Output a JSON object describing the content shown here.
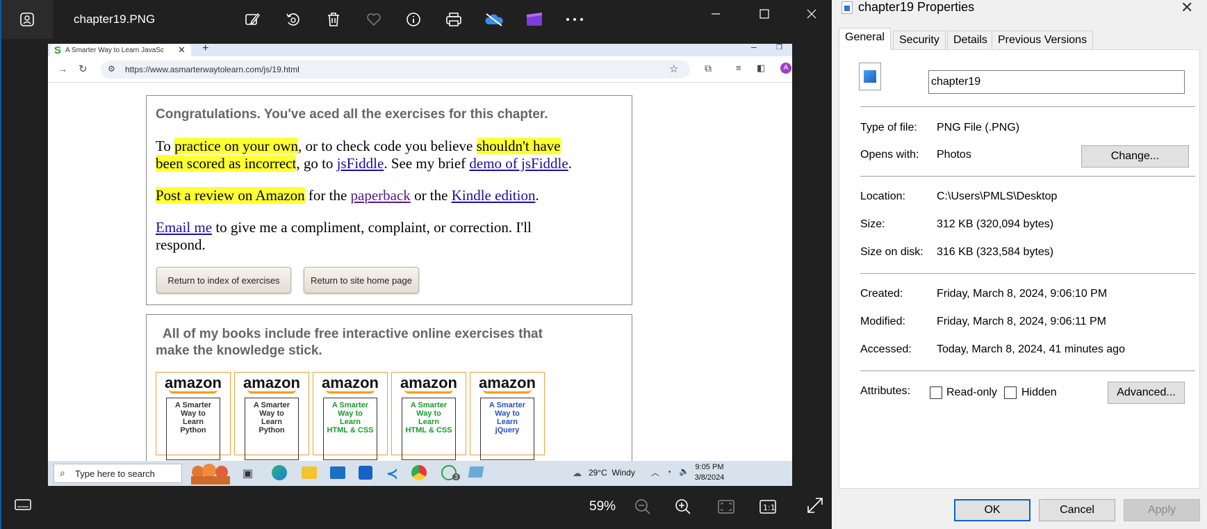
{
  "viewer": {
    "title": "chapter19.PNG",
    "zoom": "59%",
    "toolbar": [
      "edit-image-icon",
      "rotate-icon",
      "delete-icon",
      "favorite-icon",
      "info-icon",
      "print-icon",
      "onedrive-icon",
      "clipchamp-icon",
      "more-icon"
    ]
  },
  "browser": {
    "tab_title": "A Smarter Way to Learn JavaSc",
    "url": "https://www.asmarterwaytolearn.com/js/19.html"
  },
  "page": {
    "congrats_heading": "Congratulations. You've aced all the exercises for this chapter.",
    "p1_a": "To ",
    "p1_hl1": "practice on your own",
    "p1_b": ", or to check code you believe ",
    "p1_hl2a": "shouldn't have",
    "p1_hl2b": "been scored as incorrect",
    "p1_c": ", go to ",
    "p1_link1": "jsFiddle",
    "p1_d": ". See my brief ",
    "p1_link2": "demo of jsFiddle",
    "p1_e": ".",
    "p2_hl": "Post a review on Amazon",
    "p2_a": " for the ",
    "p2_link1": "paperback",
    "p2_b": " or the ",
    "p2_link2": "Kindle edition",
    "p2_c": ".",
    "p3_link": "Email me",
    "p3_a": " to give me a compliment, complaint, or correction. I'll",
    "p3_b": "respond.",
    "btn_index": "Return to index of exercises",
    "btn_home": "Return to site home page",
    "books_heading_1": "All of my books include free interactive online exercises that",
    "books_heading_2": "make the knowledge stick.",
    "books": [
      {
        "brand": "amazon",
        "cover": [
          "A Smarter",
          "Way to",
          "Learn",
          "Python"
        ],
        "color": "#333333"
      },
      {
        "brand": "amazon",
        "cover": [
          "A Smarter",
          "Way to",
          "Learn",
          "Python"
        ],
        "color": "#333333"
      },
      {
        "brand": "amazon",
        "cover": [
          "A Smarter",
          "Way to",
          "Learn",
          "HTML & CSS"
        ],
        "color": "#1a9a2a"
      },
      {
        "brand": "amazon",
        "cover": [
          "A Smarter",
          "Way to",
          "Learn",
          "HTML & CSS"
        ],
        "color": "#1a9a2a"
      },
      {
        "brand": "amazon",
        "cover": [
          "A Smarter",
          "Way to",
          "Learn",
          "jQuery"
        ],
        "color": "#2a4fc0"
      }
    ]
  },
  "taskbar": {
    "search_placeholder": "Type here to search",
    "weather": "29°C  Windy",
    "time": "9:05 PM",
    "date": "3/8/2024",
    "whatsapp_badge": "3"
  },
  "props": {
    "title": "chapter19 Properties",
    "tabs": [
      "General",
      "Security",
      "Details",
      "Previous Versions"
    ],
    "filename": "chapter19",
    "type_label": "Type of file:",
    "type_value": "PNG File (.PNG)",
    "opens_label": "Opens with:",
    "opens_value": "Photos",
    "change_btn": "Change...",
    "location_label": "Location:",
    "location_value": "C:\\Users\\PMLS\\Desktop",
    "size_label": "Size:",
    "size_value": "312 KB (320,094 bytes)",
    "disk_label": "Size on disk:",
    "disk_value": "316 KB (323,584 bytes)",
    "created_label": "Created:",
    "created_value": "Friday, March 8, 2024, 9:06:10 PM",
    "modified_label": "Modified:",
    "modified_value": "Friday, March 8, 2024, 9:06:11 PM",
    "accessed_label": "Accessed:",
    "accessed_value": "Today, March 8, 2024, 41 minutes ago",
    "attr_label": "Attributes:",
    "readonly": "Read-only",
    "hidden": "Hidden",
    "advanced_btn": "Advanced...",
    "ok": "OK",
    "cancel": "Cancel",
    "apply": "Apply"
  }
}
